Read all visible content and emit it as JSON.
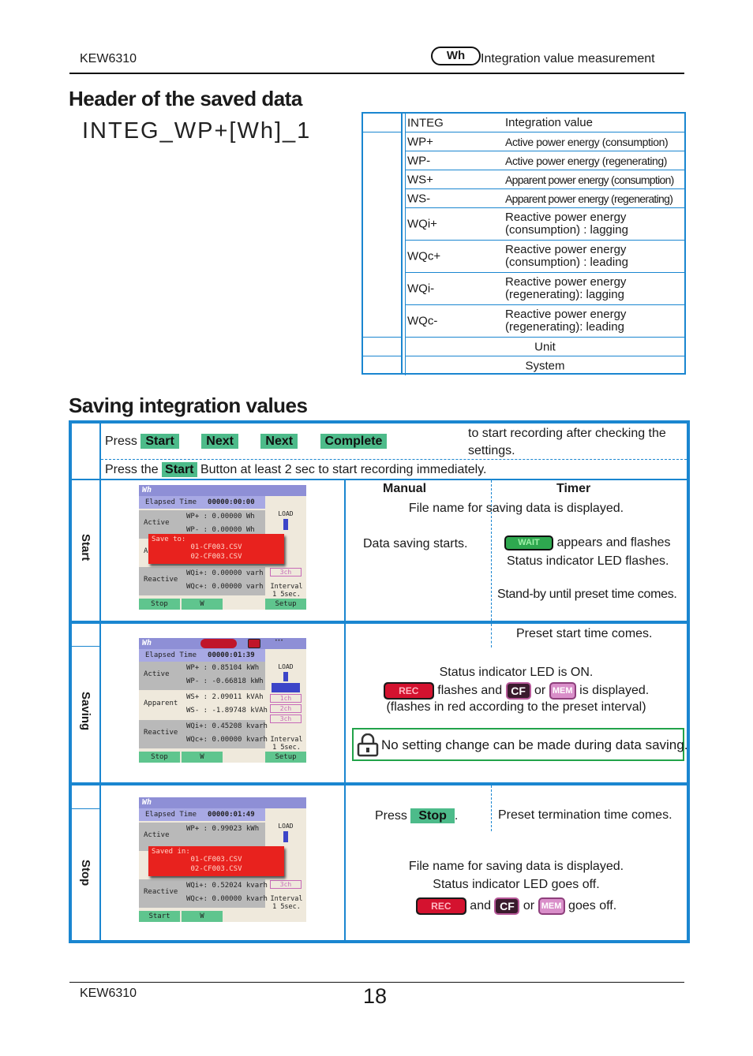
{
  "header": {
    "model": "KEW6310",
    "badge": "Wh",
    "section": "Integration value measurement"
  },
  "saved_data_header": {
    "title": "Header of the saved data",
    "example": "INTEG_WP+[Wh]_1",
    "rows": [
      {
        "code": "INTEG",
        "description": "Integration value"
      },
      {
        "code": "WP+",
        "description": "Active power energy (consumption)"
      },
      {
        "code": "WP-",
        "description": "Active power energy (regenerating)"
      },
      {
        "code": "WS+",
        "description": "Apparent power energy (consumption)"
      },
      {
        "code": "WS-",
        "description": "Apparent power energy (regenerating)"
      },
      {
        "code": "WQi+",
        "description_1": "Reactive power energy",
        "description_2": "(consumption) : lagging"
      },
      {
        "code": "WQc+",
        "description_1": "Reactive power energy",
        "description_2": "(consumption) : leading"
      },
      {
        "code": "WQi-",
        "description_1": "Reactive power energy",
        "description_2": "(regenerating): lagging"
      },
      {
        "code": "WQc-",
        "description_1": "Reactive power energy",
        "description_2": "(regenerating): leading"
      },
      {
        "label": "Unit"
      },
      {
        "label": "System"
      }
    ]
  },
  "saving": {
    "title": "Saving integration values",
    "intro": {
      "press": "Press",
      "buttons": [
        "Start",
        "Next",
        "Next",
        "Complete"
      ],
      "after": "to start recording after checking the",
      "after2": "settings.",
      "press_the": "Press the",
      "start_btn": "Start",
      "hold_text": "Button at least 2 sec to start recording immediately."
    },
    "columns": {
      "manual": "Manual",
      "timer": "Timer"
    },
    "start": {
      "label": "Start",
      "filename_text": "File name for saving data is displayed.",
      "manual_text": "Data saving starts.",
      "wait_icon": "WAIT",
      "timer_text_1": "appears and flashes",
      "timer_text_2": "Status indicator LED flashes.",
      "timer_text_3": "Stand-by until preset time comes.",
      "screen": {
        "logo": "Wh",
        "elapsed_label": "Elapsed Time",
        "elapsed": "00000:00:00",
        "active": "Active",
        "wp_plus": "WP+ :  0.00000  Wh",
        "wp_minus": "WP- :  0.00000  Wh",
        "apparent": "Apparent",
        "reactive": "Reactive",
        "wqi": "WQi+:  0.00000  varh",
        "wqc": "WQc+:  0.00000  varh",
        "popup_title": "Save to:",
        "file1": "01-CF003.CSV",
        "file2": "02-CF003.CSV",
        "load": "LOAD",
        "ch3": "3ch",
        "interval_1": "Interval",
        "interval_2": "1 5sec.",
        "btn_stop": "Stop",
        "btn_w": "W",
        "btn_setup": "Setup"
      }
    },
    "saving_row": {
      "label": "Saving",
      "timer_text": "Preset start time comes.",
      "led_text": "Status indicator LED is ON.",
      "rec_icon": "REC",
      "flash_text": "flashes and",
      "cf_icon": "CF",
      "or": "or",
      "mem_icon": "MEM",
      "displayed_text": "is displayed.",
      "interval_text": "(flashes in red according to the preset interval)",
      "lock_note": "No setting change can be made during data saving.",
      "screen": {
        "logo": "Wh",
        "elapsed_label": "Elapsed Time",
        "elapsed": "00000:01:39",
        "active": "Active",
        "wp_plus": "WP+ :  0.85104 kWh",
        "wp_minus": "WP- : -0.66818 kWh",
        "apparent": "Apparent",
        "ws_plus": "WS+ :  2.09011 kVAh",
        "ws_minus": "WS- : -1.89748 kVAh",
        "reactive": "Reactive",
        "wqi": "WQi+:  0.45208 kvarh",
        "wqc": "WQc+:  0.00000 kvarh",
        "load": "LOAD",
        "ch1": "1ch",
        "ch2": "2ch",
        "ch3": "3ch",
        "interval_1": "Interval",
        "interval_2": "1 5sec.",
        "btn_stop": "Stop",
        "btn_w": "W",
        "btn_setup": "Setup"
      }
    },
    "stop": {
      "label": "Stop",
      "press": "Press",
      "stop_btn": "Stop",
      "timer_text": "Preset termination time comes.",
      "filename_text": "File name for saving data is displayed.",
      "led_text": "Status indicator LED goes off.",
      "rec_icon": "REC",
      "and": "and",
      "cf_icon": "CF",
      "or": "or",
      "mem_icon": "MEM",
      "off_text": "goes off.",
      "screen": {
        "logo": "Wh",
        "elapsed_label": "Elapsed Time",
        "elapsed": "00000:01:49",
        "active": "Active",
        "wp_plus": "WP+ :  0.99023 kWh",
        "reactive": "Reactive",
        "wqi": "WQi+:  0.52024 kvarh",
        "wqc": "WQc+:  0.00000 kvarh",
        "popup_title": "Saved in:",
        "file1": "01-CF003.CSV",
        "file2": "02-CF003.CSV",
        "load": "LOAD",
        "ch3": "3ch",
        "interval_1": "Interval",
        "interval_2": "1 5sec.",
        "btn_start": "Start",
        "btn_w": "W"
      }
    }
  },
  "footer": {
    "model": "KEW6310",
    "page": "18"
  }
}
